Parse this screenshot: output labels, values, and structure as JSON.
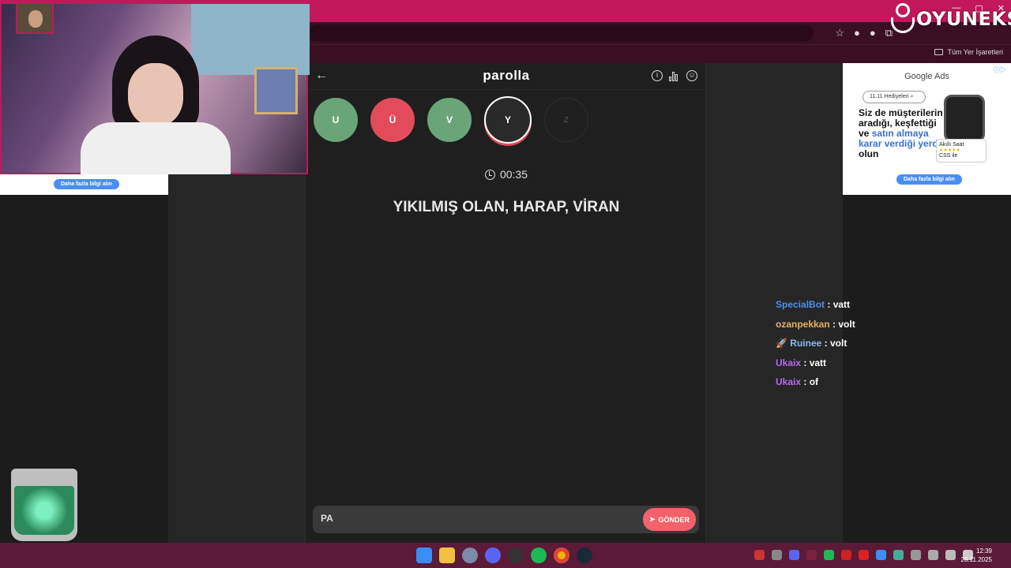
{
  "browser": {
    "bookmarks_all": "Tüm Yer İşaretleri",
    "window_controls": [
      "—",
      "▢",
      "✕"
    ]
  },
  "logo": {
    "text": "OYUNEKS"
  },
  "game": {
    "title": "parolla",
    "letters": [
      {
        "char": "U",
        "state": "correct"
      },
      {
        "char": "Ü",
        "state": "wrong"
      },
      {
        "char": "V",
        "state": "correct"
      },
      {
        "char": "Y",
        "state": "current"
      },
      {
        "char": "Z",
        "state": "pending"
      }
    ],
    "timer": "00:35",
    "clue": "YIKILMIŞ OLAN, HARAP, VİRAN",
    "answer_value": "PA",
    "send_label": "GÖNDER"
  },
  "left_ad": {
    "more_info": "Daha fazla bilgi alın"
  },
  "right_ad": {
    "brand": "Google Ads",
    "search_text": "11.11 Hediyeleri",
    "headline_parts": [
      "Siz de müşterilerin aradığı, keşfettiği ve ",
      "satın almaya karar verdiği yerde",
      " olun"
    ],
    "product_name": "Akıllı Saat",
    "product_source": "CSS ile",
    "more_info": "Daha fazla bilgi alın"
  },
  "chat": [
    {
      "user": "SpecialBot",
      "message": "vatt",
      "color": "#4d8ef0",
      "badge": ""
    },
    {
      "user": "ozanpekkan",
      "message": "volt",
      "color": "#e8b060",
      "badge": ""
    },
    {
      "user": "Ruinee",
      "message": "volt",
      "color": "#8ab8f0",
      "badge": "🚀"
    },
    {
      "user": "Ukaix",
      "message": "vatt",
      "color": "#b56af0",
      "badge": ""
    },
    {
      "user": "Ukaix",
      "message": "of",
      "color": "#b56af0",
      "badge": ""
    }
  ],
  "taskbar": {
    "time": "12:39",
    "date": "26.11.2025",
    "apps": [
      "windows-start",
      "file-explorer",
      "app-3",
      "discord",
      "obs",
      "spotify",
      "chrome",
      "steam"
    ]
  }
}
